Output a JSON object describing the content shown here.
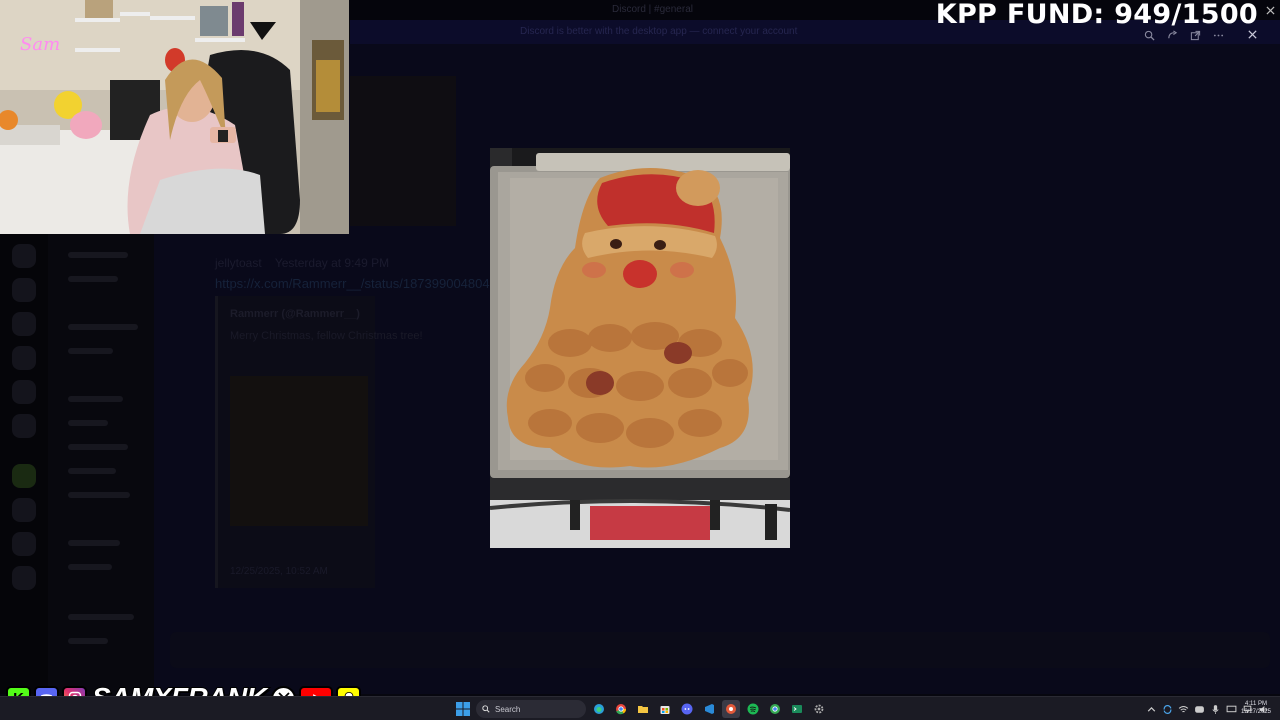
{
  "background": {
    "window_title": "Discord | #general",
    "banner_text": "Discord is better with the desktop app — connect your account",
    "message_author": "jellytoast",
    "message_time": "Yesterday at 9:49 PM",
    "message_link": "https://x.com/Rammerr__/status/1873990048042 ... (blurred)",
    "embed_author": "Rammerr (@Rammerr__)",
    "embed_text": "Merry Christmas, fellow Christmas tree!",
    "embed_timestamp": "12/25/2025, 10:52 AM"
  },
  "viewer": {
    "controls": [
      "zoom-icon",
      "rotate-icon",
      "open-external-icon",
      "more-icon"
    ],
    "close_icon": "close-icon"
  },
  "overlay": {
    "fund_label": "KPP FUND: 949/1500",
    "fund_current": 949,
    "fund_goal": 1500,
    "webcam_neon_sign": "Sam",
    "social_handle": "SAMXFRANK",
    "social_icons": [
      "kick-icon",
      "discord-icon",
      "instagram-icon",
      "x-icon",
      "youtube-icon",
      "snapchat-icon"
    ]
  },
  "taskbar": {
    "search_placeholder": "Search",
    "clock_time": "4:11 PM",
    "clock_date": "12/27/2025",
    "colors": {
      "bar": "#1b1b24",
      "accent": "#0078d4"
    }
  }
}
